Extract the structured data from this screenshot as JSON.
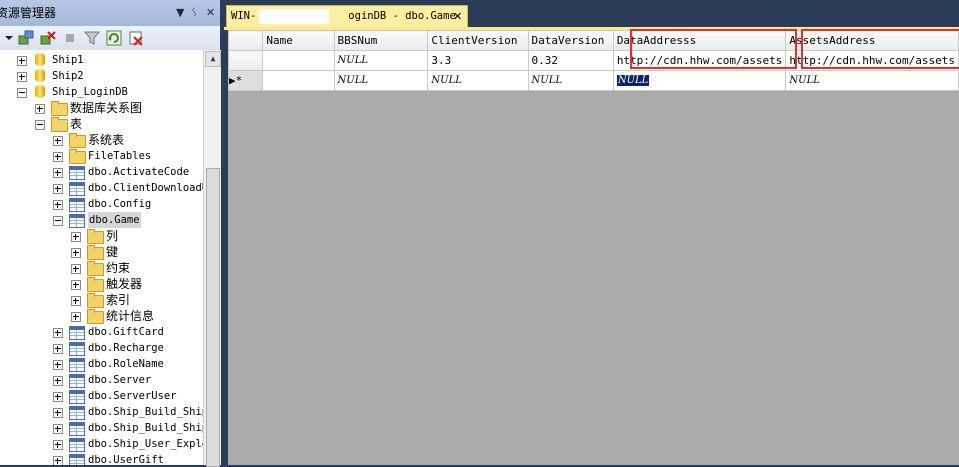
{
  "explorer": {
    "title": "资源管理器",
    "title_buttons": [
      "▼",
      "ᛊ",
      "✕"
    ],
    "toolbar_icons": [
      "connect-icon",
      "disconnect-icon",
      "stop-icon",
      "filter-icon",
      "refresh-icon",
      "delete-icon"
    ],
    "tree": [
      {
        "label": "Ship1",
        "type": "database",
        "level": 0,
        "expanded": false
      },
      {
        "label": "Ship2",
        "type": "database",
        "level": 0,
        "expanded": false
      },
      {
        "label": "Ship_LoginDB",
        "type": "database",
        "level": 0,
        "expanded": true
      },
      {
        "label": "数据库关系图",
        "type": "folder",
        "level": 1,
        "expanded": false
      },
      {
        "label": "表",
        "type": "folder",
        "level": 1,
        "expanded": true
      },
      {
        "label": "系统表",
        "type": "folder",
        "level": 2,
        "expanded": false
      },
      {
        "label": "FileTables",
        "type": "folder",
        "level": 2,
        "expanded": false
      },
      {
        "label": "dbo.ActivateCode",
        "type": "table",
        "level": 2,
        "expanded": false
      },
      {
        "label": "dbo.ClientDownloadU",
        "type": "table",
        "level": 2,
        "expanded": false
      },
      {
        "label": "dbo.Config",
        "type": "table",
        "level": 2,
        "expanded": false
      },
      {
        "label": "dbo.Game",
        "type": "table",
        "level": 2,
        "expanded": true,
        "selected": true
      },
      {
        "label": "列",
        "type": "folder",
        "level": 3,
        "expanded": false
      },
      {
        "label": "键",
        "type": "folder",
        "level": 3,
        "expanded": false
      },
      {
        "label": "约束",
        "type": "folder",
        "level": 3,
        "expanded": false
      },
      {
        "label": "触发器",
        "type": "folder",
        "level": 3,
        "expanded": false
      },
      {
        "label": "索引",
        "type": "folder",
        "level": 3,
        "expanded": false
      },
      {
        "label": "统计信息",
        "type": "folder",
        "level": 3,
        "expanded": false
      },
      {
        "label": "dbo.GiftCard",
        "type": "table",
        "level": 2,
        "expanded": false
      },
      {
        "label": "dbo.Recharge",
        "type": "table",
        "level": 2,
        "expanded": false
      },
      {
        "label": "dbo.RoleName",
        "type": "table",
        "level": 2,
        "expanded": false
      },
      {
        "label": "dbo.Server",
        "type": "table",
        "level": 2,
        "expanded": false
      },
      {
        "label": "dbo.ServerUser",
        "type": "table",
        "level": 2,
        "expanded": false
      },
      {
        "label": "dbo.Ship_Build_Ship",
        "type": "table",
        "level": 2,
        "expanded": false
      },
      {
        "label": "dbo.Ship_Build_Ship",
        "type": "table",
        "level": 2,
        "expanded": false
      },
      {
        "label": "dbo.Ship_User_Explo",
        "type": "table",
        "level": 2,
        "expanded": false
      },
      {
        "label": "dbo.UserGift",
        "type": "table",
        "level": 2,
        "expanded": false
      }
    ]
  },
  "document": {
    "tab": {
      "prefix": "WIN-",
      "suffix": "oginDB - dbo.Game",
      "close": "✕"
    },
    "grid": {
      "columns": [
        "Name",
        "BBSNum",
        "ClientVersion",
        "DataVersion",
        "DataAddresss",
        "AssetsAddress"
      ],
      "rows": [
        {
          "marker": "",
          "cells": [
            "",
            "NULL",
            "3.3",
            "0.32",
            "http://cdn.hhw.com/assets",
            "http://cdn.hhw.com/assets"
          ]
        },
        {
          "marker": "▶*",
          "cells": [
            "",
            "NULL",
            "NULL",
            "NULL",
            "NULL",
            "NULL"
          ]
        }
      ]
    },
    "highlight_color": "#e03030"
  }
}
